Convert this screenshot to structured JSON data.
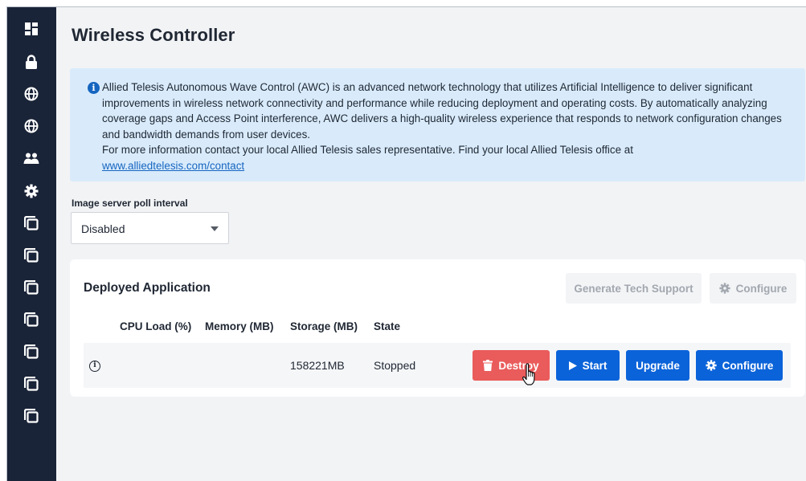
{
  "sidebar": {
    "items": [
      {
        "icon": "dashboard-icon"
      },
      {
        "icon": "lock-icon"
      },
      {
        "icon": "globe-icon"
      },
      {
        "icon": "globe-icon"
      },
      {
        "icon": "users-icon"
      },
      {
        "icon": "gear-icon"
      },
      {
        "icon": "windows-icon"
      },
      {
        "icon": "windows-icon"
      },
      {
        "icon": "windows-icon"
      },
      {
        "icon": "windows-icon"
      },
      {
        "icon": "windows-icon"
      },
      {
        "icon": "windows-icon"
      },
      {
        "icon": "windows-icon"
      }
    ]
  },
  "page": {
    "title": "Wireless Controller"
  },
  "info": {
    "paragraph": "Allied Telesis Autonomous Wave Control (AWC) is an advanced network technology that utilizes Artificial Intelligence to deliver significant improvements in wireless network connectivity and performance while reducing deployment and operating costs. By automatically analyzing coverage gaps and Access Point interference, AWC delivers a high-quality wireless experience that responds to network configuration changes and bandwidth demands from user devices.",
    "contact_text": "For more information contact your local Allied Telesis sales representative. Find your local Allied Telesis office at",
    "link": "www.alliedtelesis.com/contact"
  },
  "poll": {
    "label": "Image server poll interval",
    "value": "Disabled"
  },
  "deployed": {
    "title": "Deployed Application",
    "generate_tech_support": "Generate Tech Support",
    "configure": "Configure",
    "columns": {
      "cpu": "CPU Load (%)",
      "memory": "Memory (MB)",
      "storage": "Storage (MB)",
      "state": "State"
    },
    "row": {
      "cpu": "",
      "memory": "",
      "storage": "158221MB",
      "state": "Stopped"
    },
    "actions": {
      "destroy": "Destroy",
      "start": "Start",
      "upgrade": "Upgrade",
      "configure": "Configure"
    }
  },
  "colors": {
    "sidebar": "#1a2438",
    "background": "#f2f3f5",
    "info_bg": "#d9ebfb",
    "primary": "#0b63d9",
    "danger": "#ea5b5b"
  }
}
